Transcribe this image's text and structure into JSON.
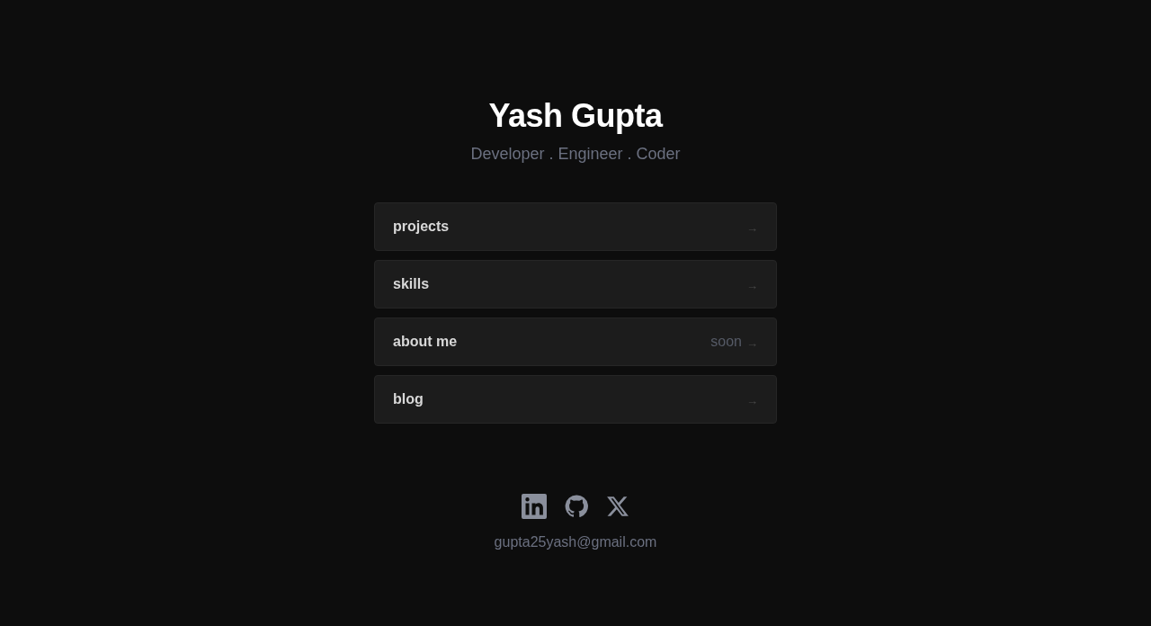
{
  "header": {
    "name": "Yash Gupta",
    "tagline": "Developer . Engineer . Coder"
  },
  "links": [
    {
      "label": "projects",
      "arrow": "→"
    },
    {
      "label": "skills",
      "arrow": "→"
    },
    {
      "label": "about me",
      "badge": "soon",
      "arrow": "→"
    },
    {
      "label": "blog",
      "arrow": "→"
    }
  ],
  "social": {
    "icons": [
      {
        "kind": "linkedin"
      },
      {
        "kind": "github"
      },
      {
        "kind": "x"
      }
    ],
    "email": "gupta25yash@gmail.com"
  }
}
